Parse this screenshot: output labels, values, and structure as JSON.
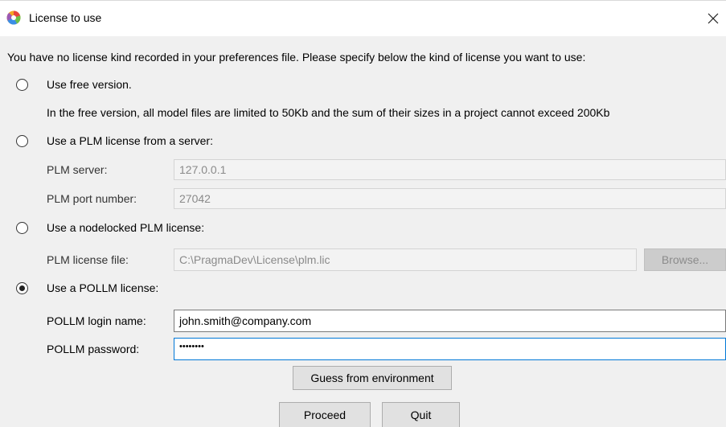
{
  "window": {
    "title": "License to use",
    "app_icon": "pragmadev-logo-icon",
    "close_glyph": "close-icon"
  },
  "intro_text": "You have no license kind recorded in your preferences file. Please specify below the kind of license you want to use:",
  "options": {
    "free": {
      "label": "Use free version.",
      "selected": false,
      "description": "In the free version, all model files are limited to 50Kb and the sum of their sizes in a project cannot exceed 200Kb"
    },
    "plm_server": {
      "label": "Use a PLM license from a server:",
      "selected": false,
      "server_label": "PLM server:",
      "server_value": "127.0.0.1",
      "port_label": "PLM port number:",
      "port_value": "27042"
    },
    "plm_nodelocked": {
      "label": "Use a nodelocked PLM license:",
      "selected": false,
      "file_label": "PLM license file:",
      "file_value": "C:\\PragmaDev\\License\\plm.lic",
      "browse_label": "Browse..."
    },
    "pollm": {
      "label": "Use a POLLM license:",
      "selected": true,
      "login_label": "POLLM login name:",
      "login_value": "john.smith@company.com",
      "password_label": "POLLM password:",
      "password_value": "••••••••"
    }
  },
  "buttons": {
    "guess": "Guess from environment",
    "proceed": "Proceed",
    "quit": "Quit"
  }
}
